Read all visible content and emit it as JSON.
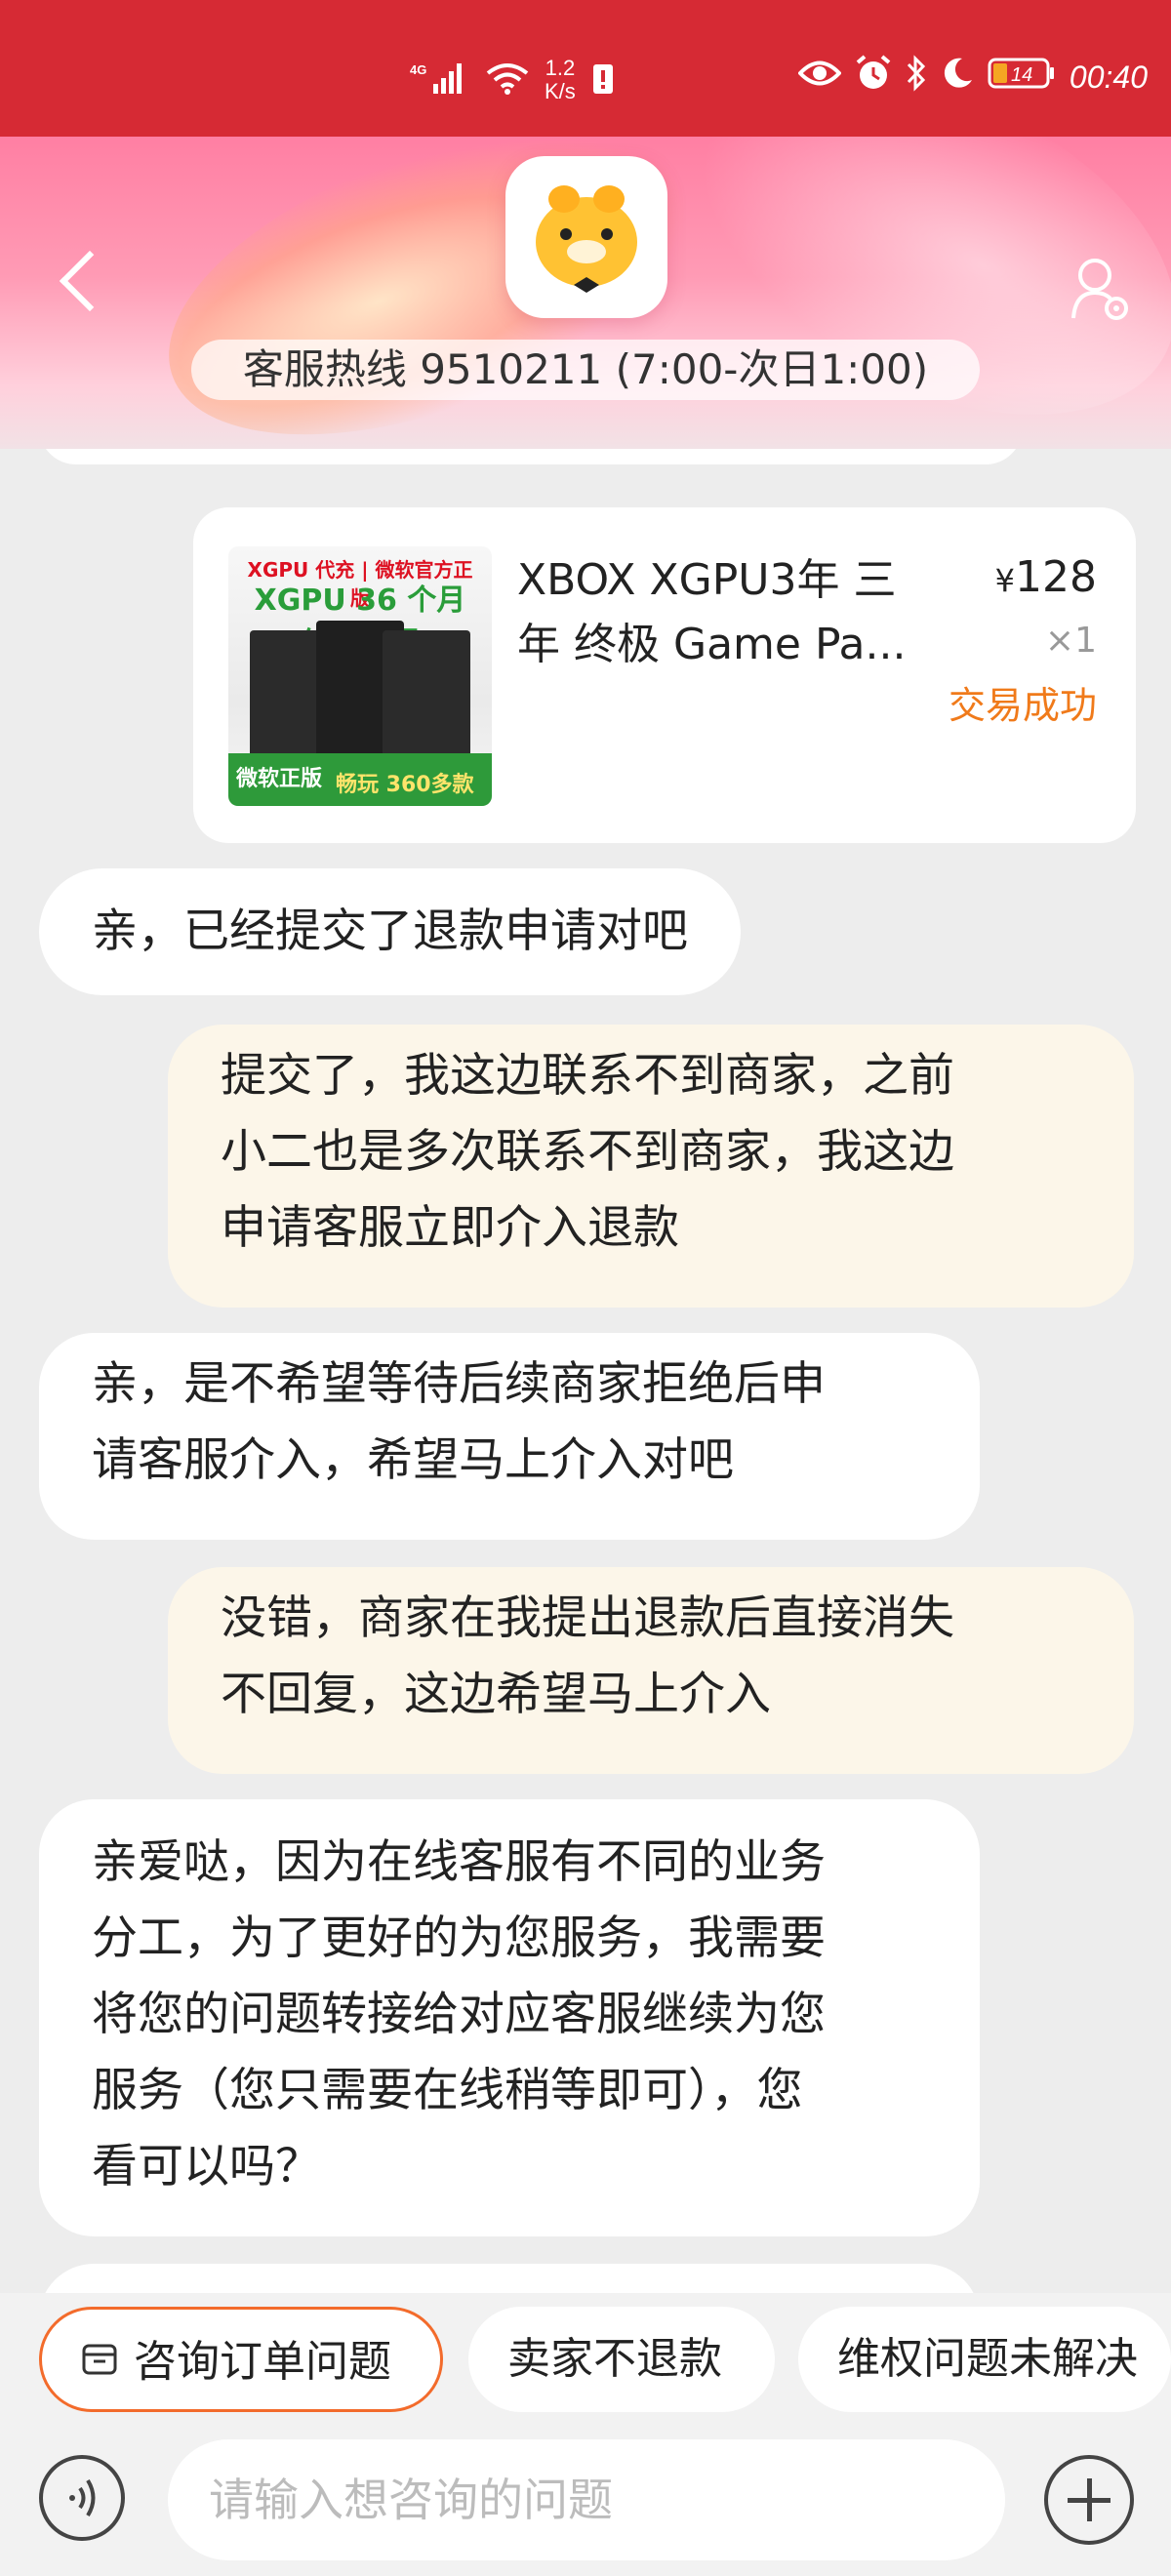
{
  "status_bar": {
    "network": "4G",
    "speed": [
      "1.2",
      "K/s"
    ],
    "battery": "14",
    "time": "00:40"
  },
  "header": {
    "hotline": "客服热线 9510211 (7:00-次日1:00)"
  },
  "product": {
    "thumb_lines": [
      "XGPU 代充 | 微软官方正版",
      "XGPU 36 个月 终极通票",
      "微软正版",
      "畅玩 360多款"
    ],
    "title": "XBOX XGPU3年 三年 终极 Game Pa...",
    "currency": "¥",
    "price": "128",
    "quantity": "×1",
    "status": "交易成功"
  },
  "messages": [
    {
      "side": "left",
      "lines": [
        "亲，已经提交了退款申请对吧"
      ]
    },
    {
      "side": "right",
      "lines": [
        "提交了，我这边联系不到商家，之前",
        "小二也是多次联系不到商家，我这边",
        "申请客服立即介入退款"
      ]
    },
    {
      "side": "left",
      "lines": [
        "亲，是不希望等待后续商家拒绝后申",
        "请客服介入，希望马上介入对吧"
      ]
    },
    {
      "side": "right",
      "lines": [
        "没错，商家在我提出退款后直接消失",
        "不回复，这边希望马上介入"
      ]
    },
    {
      "side": "left",
      "lines": [
        "亲爱哒，因为在线客服有不同的业务",
        "分工，为了更好的为您服务，我需要",
        "将您的问题转接给对应客服继续为您",
        "服务（您只需要在线稍等即可），您",
        "看可以吗？"
      ]
    }
  ],
  "quick_replies": [
    "咨询订单问题",
    "卖家不退款",
    "维权问题未解决"
  ],
  "input": {
    "placeholder": "请输入想咨询的问题"
  },
  "colors": {
    "status_bar": "#d62a34",
    "accent_orange": "#f36b2b",
    "success_text": "#f07a1a",
    "user_bubble": "#fcf6e9"
  }
}
